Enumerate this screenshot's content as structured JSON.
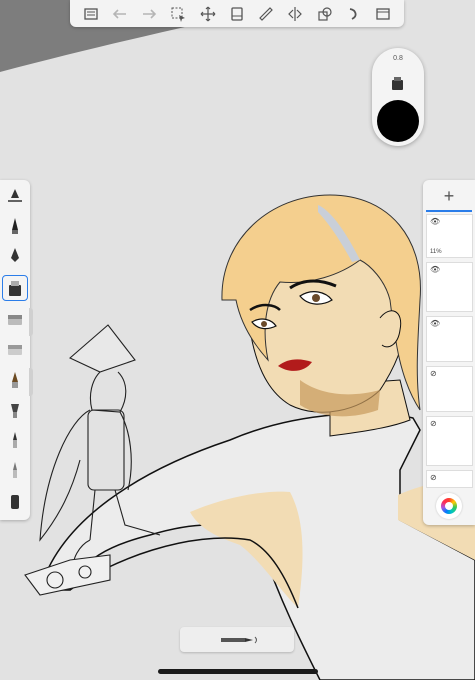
{
  "brush_puck": {
    "size_label": "0.8",
    "color": "#000000"
  },
  "layers": {
    "add_label": "+",
    "layer1_opacity": "11%"
  },
  "colors": {
    "accent": "#2b7de9",
    "skin": "#f2dcb4",
    "hair": "#f4cf8e",
    "lips": "#b21b1b"
  },
  "toolbar": {
    "icons": [
      "gallery-icon",
      "undo-icon",
      "redo-icon",
      "selection-icon",
      "transform-icon",
      "layer-icon",
      "ruler-icon",
      "symmetry-icon",
      "shapes-icon",
      "french-curve-icon",
      "fullscreen-icon"
    ]
  },
  "brush_palette": {
    "icons": [
      "pencil-ruler-icon",
      "ballpoint-pen-icon",
      "fountain-pen-icon",
      "marker-icon",
      "eraser-icon",
      "soft-eraser-icon",
      "pencil-icon",
      "airbrush-icon",
      "paintbrush-icon",
      "brush-icon",
      "smudge-icon"
    ]
  },
  "bottom_bar": {
    "icon": "pen-pressure-icon"
  }
}
